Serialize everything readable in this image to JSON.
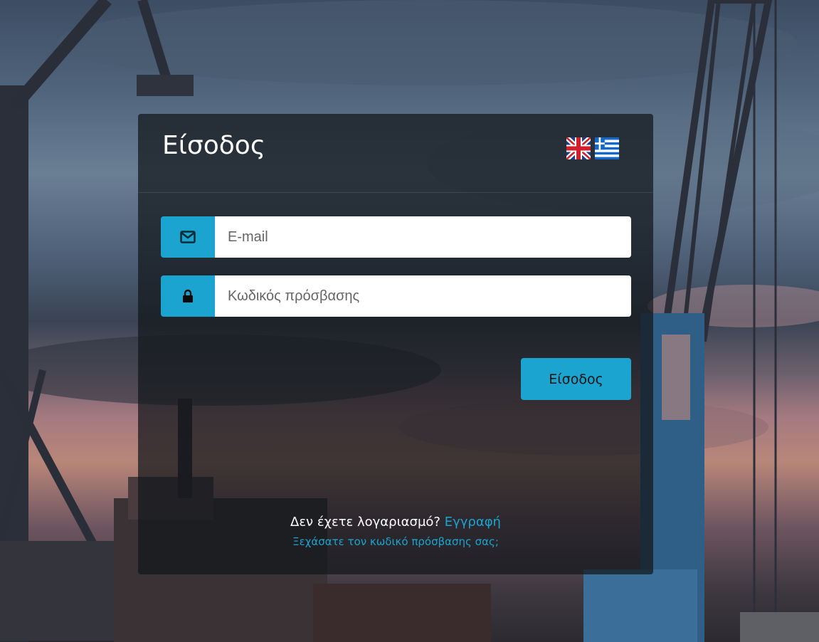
{
  "login": {
    "title": "Είσοδος",
    "email_placeholder": "E-mail",
    "password_placeholder": "Κωδικός πρόσβασης",
    "submit_label": "Είσοδος",
    "no_account_text": "Δεν έχετε λογαριασμό?",
    "register_link": "Εγγραφή",
    "forgot_password_link": "Ξεχάσατε τον κωδικό πρόσβασης σας;"
  },
  "languages": [
    {
      "name": "uk-flag-icon"
    },
    {
      "name": "greece-flag-icon"
    }
  ],
  "colors": {
    "accent": "#1aa4cf",
    "card_bg": "rgba(18,22,26,0.72)"
  }
}
